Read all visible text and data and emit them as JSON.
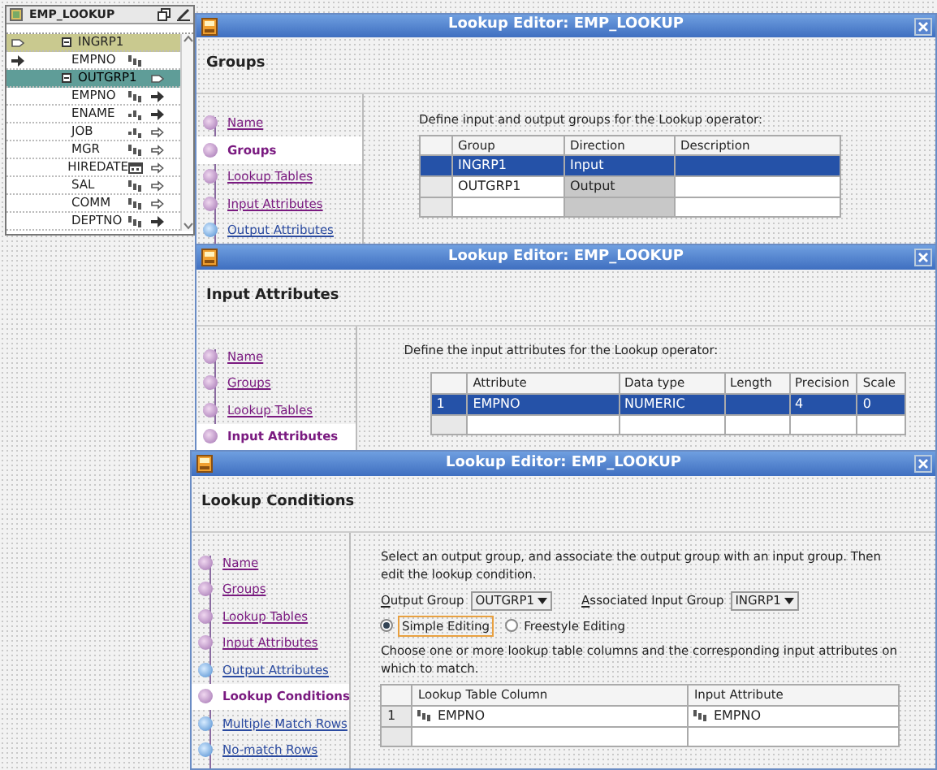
{
  "operator": {
    "title": "EMP_LOOKUP",
    "groups": [
      {
        "name": "INGRP1",
        "kind": "input",
        "expanded": true,
        "attributes": [
          {
            "name": "EMPNO",
            "kind": "number",
            "connected": true
          }
        ]
      },
      {
        "name": "OUTGRP1",
        "kind": "output",
        "expanded": true,
        "attributes": [
          {
            "name": "EMPNO",
            "kind": "number",
            "connected": true
          },
          {
            "name": "ENAME",
            "kind": "text",
            "connected": true
          },
          {
            "name": "JOB",
            "kind": "text",
            "connected": false
          },
          {
            "name": "MGR",
            "kind": "number",
            "connected": false
          },
          {
            "name": "HIREDATE",
            "kind": "date",
            "connected": false
          },
          {
            "name": "SAL",
            "kind": "number",
            "connected": false
          },
          {
            "name": "COMM",
            "kind": "number",
            "connected": false
          },
          {
            "name": "DEPTNO",
            "kind": "number",
            "connected": true
          }
        ]
      }
    ]
  },
  "dialogs": [
    {
      "title": "Lookup Editor: EMP_LOOKUP",
      "heading": "Groups",
      "steps": [
        {
          "label": "Name",
          "visited": true,
          "selected": false
        },
        {
          "label": "Groups",
          "visited": true,
          "selected": true
        },
        {
          "label": "Lookup Tables",
          "visited": true,
          "selected": false
        },
        {
          "label": "Input Attributes",
          "visited": true,
          "selected": false
        },
        {
          "label": "Output Attributes",
          "visited": false,
          "selected": false
        }
      ],
      "instruction": "Define input and output groups for the Lookup operator:",
      "table": {
        "columns": [
          {
            "label": "Group",
            "read_only": false
          },
          {
            "label": "Direction",
            "read_only": true
          },
          {
            "label": "Description",
            "read_only": false
          }
        ],
        "rows": [
          {
            "selected": true,
            "cells": [
              {
                "text": "INGRP1"
              },
              {
                "text": "Input"
              },
              {}
            ]
          },
          {
            "selected": false,
            "cells": [
              {
                "text": "OUTGRP1"
              },
              {
                "text": "Output"
              },
              {}
            ]
          }
        ]
      }
    },
    {
      "title": "Lookup Editor: EMP_LOOKUP",
      "heading": "Input Attributes",
      "steps": [
        {
          "label": "Name",
          "visited": true,
          "selected": false
        },
        {
          "label": "Groups",
          "visited": true,
          "selected": false
        },
        {
          "label": "Lookup Tables",
          "visited": true,
          "selected": false
        },
        {
          "label": "Input Attributes",
          "visited": true,
          "selected": true
        }
      ],
      "instruction": "Define the input attributes for the Lookup operator:",
      "table": {
        "columns": [
          {
            "label": "Attribute",
            "read_only": false
          },
          {
            "label": "Data type",
            "read_only": false
          },
          {
            "label": "Length",
            "read_only": false
          },
          {
            "label": "Precision",
            "read_only": false
          },
          {
            "label": "Scale",
            "read_only": false
          }
        ],
        "rows": [
          {
            "number": "1",
            "selected": true,
            "cells": [
              {
                "text": "EMPNO"
              },
              {
                "text": "NUMERIC"
              },
              {},
              {
                "text": "4"
              },
              {
                "text": "0"
              }
            ]
          }
        ]
      }
    },
    {
      "title": "Lookup Editor: EMP_LOOKUP",
      "heading": "Lookup Conditions",
      "steps": [
        {
          "label": "Name",
          "visited": true,
          "selected": false
        },
        {
          "label": "Groups",
          "visited": true,
          "selected": false
        },
        {
          "label": "Lookup Tables",
          "visited": true,
          "selected": false
        },
        {
          "label": "Input Attributes",
          "visited": true,
          "selected": false
        },
        {
          "label": "Output Attributes",
          "visited": false,
          "selected": false
        },
        {
          "label": "Lookup Conditions",
          "visited": true,
          "selected": true
        },
        {
          "label": "Multiple Match Rows",
          "visited": false,
          "selected": false
        },
        {
          "label": "No-match Rows",
          "visited": false,
          "selected": false
        }
      ],
      "instruction": "Select an output group, and associate the output group with an input group. Then edit the lookup condition.",
      "form": {
        "output_group": {
          "label": "Output Group",
          "value": "OUTGRP1"
        },
        "input_group": {
          "label": "Associated Input Group",
          "value": "INGRP1"
        },
        "modes": [
          {
            "label": "Simple Editing",
            "selected": true,
            "focused": true
          },
          {
            "label": "Freestyle Editing",
            "selected": false,
            "focused": false
          }
        ]
      },
      "instruction_2": "Choose one or more lookup table columns and the corresponding input attributes on which to match.",
      "table": {
        "columns": [
          {
            "label": "Lookup Table Column",
            "read_only": false
          },
          {
            "label": "Input Attribute",
            "read_only": false
          }
        ],
        "rows": [
          {
            "number": "1",
            "selected": false,
            "cells": [
              {
                "text": "EMPNO",
                "kind": "number"
              },
              {
                "text": "EMPNO",
                "kind": "number"
              }
            ]
          }
        ]
      }
    }
  ]
}
